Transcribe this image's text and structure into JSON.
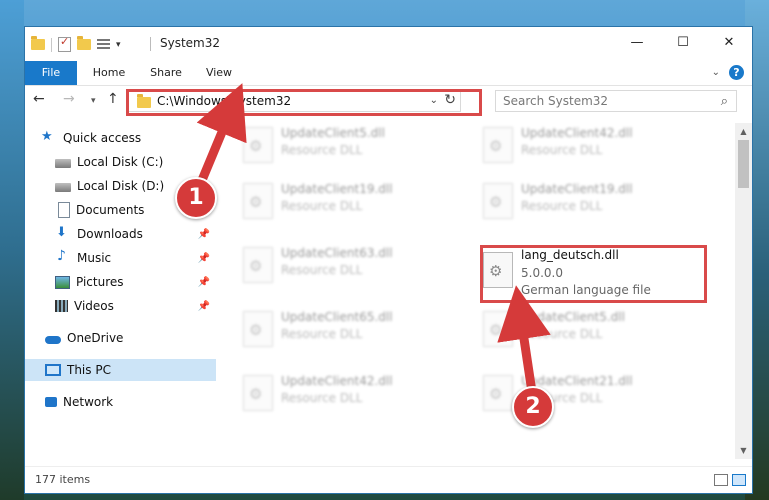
{
  "window": {
    "title": "System32",
    "controls": {
      "minimize": "—",
      "maximize": "☐",
      "close": "✕"
    }
  },
  "ribbon": {
    "tabs": [
      "File",
      "Home",
      "Share",
      "View"
    ],
    "help": "?"
  },
  "nav": {
    "back": "←",
    "forward": "→",
    "recent": "▾",
    "up": "↑",
    "address": "C:\\Windows\\System32",
    "refresh": "↻",
    "search_placeholder": "Search System32"
  },
  "sidebar": {
    "items": [
      {
        "label": "Quick access",
        "icon": "star-icon"
      },
      {
        "label": "Local Disk (C:)",
        "icon": "drive-icon"
      },
      {
        "label": "Local Disk (D:)",
        "icon": "drive-icon"
      },
      {
        "label": "Documents",
        "icon": "documents-icon"
      },
      {
        "label": "Downloads",
        "icon": "downloads-icon",
        "pinned": true
      },
      {
        "label": "Music",
        "icon": "music-icon",
        "pinned": true
      },
      {
        "label": "Pictures",
        "icon": "pictures-icon",
        "pinned": true
      },
      {
        "label": "Videos",
        "icon": "videos-icon",
        "pinned": true
      },
      {
        "label": "OneDrive",
        "icon": "onedrive-icon"
      },
      {
        "label": "This PC",
        "icon": "this-pc-icon",
        "selected": true
      },
      {
        "label": "Network",
        "icon": "network-icon"
      }
    ]
  },
  "files": [
    {
      "name": "UpdateClient5.dll",
      "type": "Resource DLL"
    },
    {
      "name": "UpdateClient42.dll",
      "type": "Resource DLL"
    },
    {
      "name": "UpdateClient19.dll",
      "type": "Resource DLL"
    },
    {
      "name": "UpdateClient19.dll",
      "type": "Resource DLL"
    },
    {
      "name": "UpdateClient63.dll",
      "type": "Resource DLL"
    },
    {
      "name": "lang_deutsch.dll",
      "version": "5.0.0.0",
      "type": "German language file",
      "highlighted": true
    },
    {
      "name": "UpdateClient65.dll",
      "type": "Resource DLL"
    },
    {
      "name": "UpdateClient5.dll",
      "type": "Resource DLL"
    },
    {
      "name": "UpdateClient42.dll",
      "type": "Resource DLL"
    },
    {
      "name": "UpdateClient21.dll",
      "type": "Resource DLL"
    }
  ],
  "status": {
    "items_count": "177 items"
  },
  "callouts": {
    "one": "1",
    "two": "2"
  },
  "colors": {
    "accent": "#1979ca",
    "highlight": "#d94a4a",
    "selected": "#cce4f7"
  }
}
